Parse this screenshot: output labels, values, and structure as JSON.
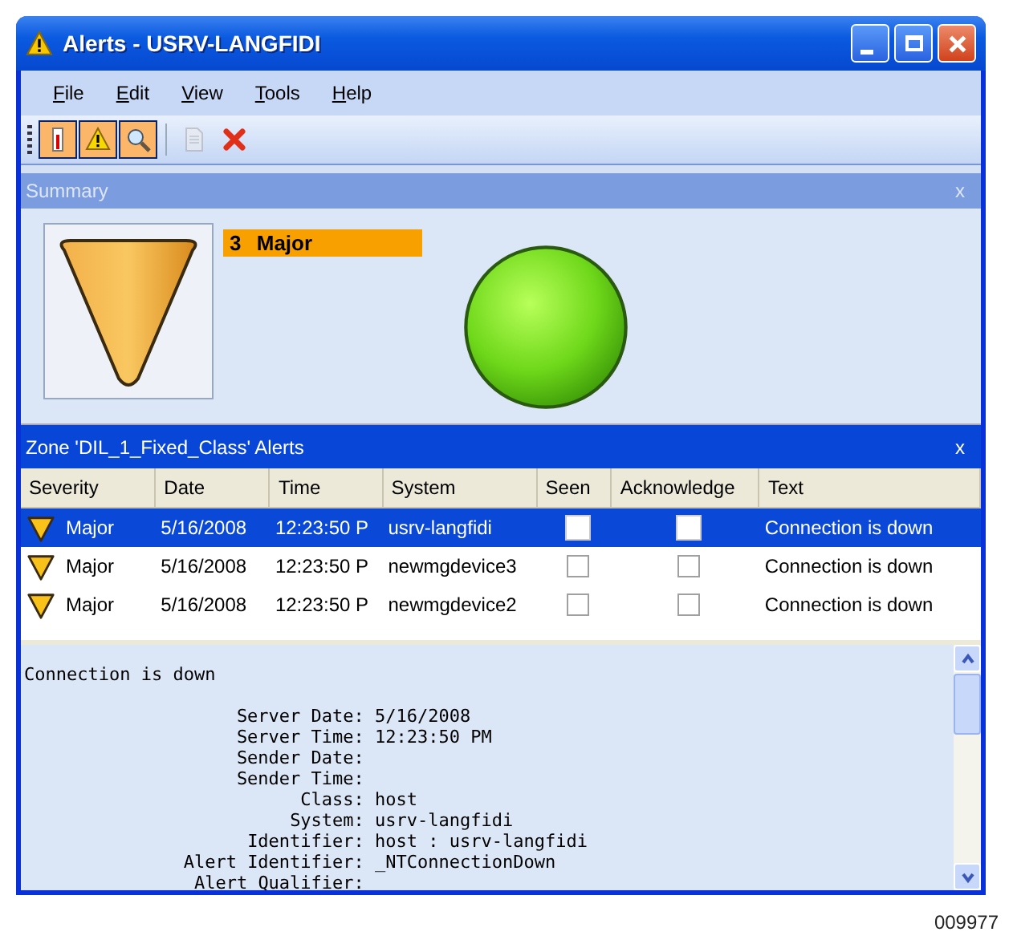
{
  "window": {
    "title": "Alerts - USRV-LANGFIDI"
  },
  "menu": [
    {
      "label": "File"
    },
    {
      "label": "Edit"
    },
    {
      "label": "View"
    },
    {
      "label": "Tools"
    },
    {
      "label": "Help"
    }
  ],
  "toolbar": [
    {
      "pressed": true,
      "disabled": false
    },
    {
      "pressed": true,
      "disabled": false
    },
    {
      "pressed": true,
      "disabled": false
    },
    {
      "pressed": false,
      "disabled": true
    },
    {
      "pressed": false,
      "disabled": false
    }
  ],
  "summary": {
    "title": "Summary",
    "close": "x",
    "count": "3",
    "severity": "Major"
  },
  "alerts": {
    "title": "Zone 'DIL_1_Fixed_Class' Alerts",
    "close": "x",
    "columns": [
      "Severity",
      "Date",
      "Time",
      "System",
      "Seen",
      "Acknowledge",
      "Text"
    ],
    "rows": [
      {
        "severity": "Major",
        "date": "5/16/2008",
        "time": "12:23:50 P",
        "system": "usrv-langfidi",
        "seen": false,
        "acknowledged": false,
        "text": "Connection is down",
        "selected": true
      },
      {
        "severity": "Major",
        "date": "5/16/2008",
        "time": "12:23:50 P",
        "system": "newmgdevice3",
        "seen": false,
        "acknowledged": false,
        "text": "Connection is down",
        "selected": false
      },
      {
        "severity": "Major",
        "date": "5/16/2008",
        "time": "12:23:50 P",
        "system": "newmgdevice2",
        "seen": false,
        "acknowledged": false,
        "text": "Connection is down",
        "selected": false
      }
    ]
  },
  "details": {
    "heading": "Connection is down",
    "fields": [
      {
        "label": "Server Date:",
        "value": "5/16/2008"
      },
      {
        "label": "Server Time:",
        "value": "12:23:50 PM"
      },
      {
        "label": "Sender Date:"
      },
      {
        "label": "Sender Time:"
      },
      {
        "label": "Class:",
        "value": "host"
      },
      {
        "label": "System:",
        "value": "usrv-langfidi"
      },
      {
        "label": "Identifier:",
        "value": "host : usrv-langfidi"
      },
      {
        "label": "Alert Identifier:",
        "value": "_NTConnectionDown"
      },
      {
        "label": "Alert Qualifier:"
      }
    ]
  },
  "figure_number": "009977"
}
